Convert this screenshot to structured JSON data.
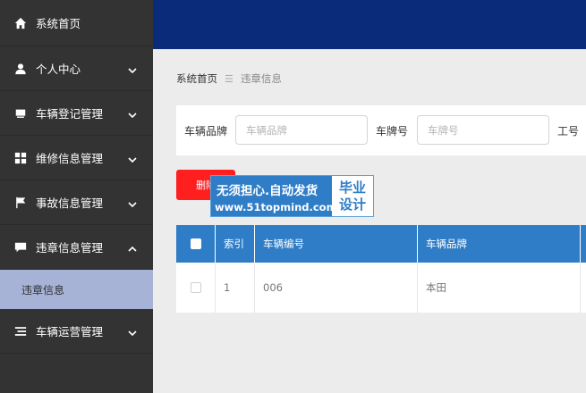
{
  "sidebar": {
    "items": [
      {
        "label": "系统首页",
        "icon": "home-icon",
        "has_arrow": false
      },
      {
        "label": "个人中心",
        "icon": "user-icon",
        "has_arrow": true,
        "expanded": false
      },
      {
        "label": "车辆登记管理",
        "icon": "car-icon",
        "has_arrow": true,
        "expanded": false
      },
      {
        "label": "维修信息管理",
        "icon": "grid-icon",
        "has_arrow": true,
        "expanded": false
      },
      {
        "label": "事故信息管理",
        "icon": "flag-icon",
        "has_arrow": true,
        "expanded": false
      },
      {
        "label": "违章信息管理",
        "icon": "chat-icon",
        "has_arrow": true,
        "expanded": true
      },
      {
        "label": "车辆运营管理",
        "icon": "list-icon",
        "has_arrow": true,
        "expanded": false
      }
    ],
    "subitem": {
      "label": "违章信息"
    }
  },
  "breadcrumb": {
    "home": "系统首页",
    "separator": "☰",
    "current": "违章信息"
  },
  "search": {
    "brand_label": "车辆品牌",
    "brand_placeholder": "车辆品牌",
    "plate_label": "车牌号",
    "plate_placeholder": "车牌号",
    "job_label": "工号"
  },
  "actions": {
    "delete_label": "删除"
  },
  "watermark": {
    "line1": "无须担心.自动发货",
    "line2": "www.51topmind.com",
    "right_top": "毕业",
    "right_bottom": "设计"
  },
  "table": {
    "columns": [
      "索引",
      "车辆编号",
      "车辆品牌"
    ],
    "rows": [
      {
        "index": "1",
        "code": "006",
        "brand": "本田"
      }
    ]
  },
  "colors": {
    "sidebar_bg": "#333333",
    "header_bg": "#0a2a7a",
    "accent": "#2f7dc7",
    "active_sub": "#a7b3d6",
    "delete": "#ff1f1f"
  }
}
